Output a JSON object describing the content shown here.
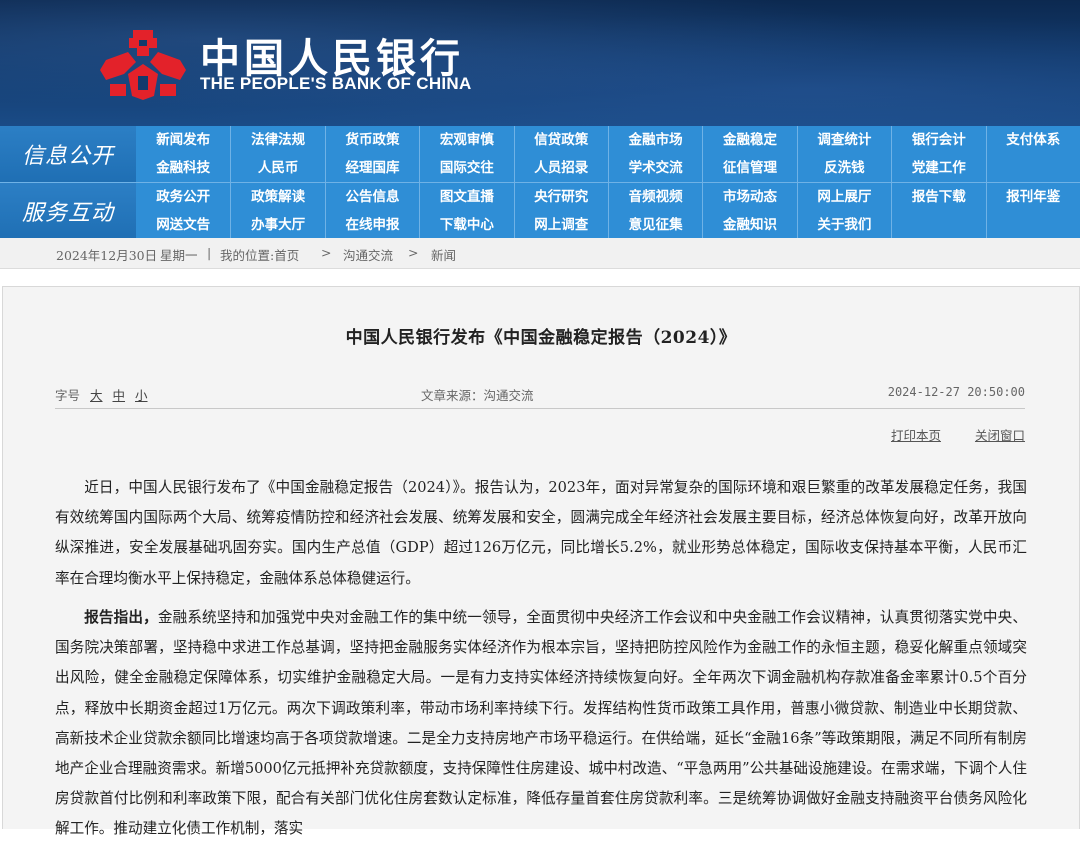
{
  "header": {
    "brand_cn": "中国人民银行",
    "brand_en": "THE PEOPLE'S BANK OF CHINA",
    "emblem_icon": "pboc-emblem-icon",
    "emblem_color": "#e3222a"
  },
  "nav": {
    "section1_label": "信息公开",
    "section2_label": "服务互动",
    "row1": [
      "新闻发布",
      "法律法规",
      "货币政策",
      "宏观审慎",
      "信贷政策",
      "金融市场",
      "金融稳定",
      "调查统计",
      "银行会计",
      "支付体系"
    ],
    "row2": [
      "金融科技",
      "人民币",
      "经理国库",
      "国际交往",
      "人员招录",
      "学术交流",
      "征信管理",
      "反洗钱",
      "党建工作",
      ""
    ],
    "row3": [
      "政务公开",
      "政策解读",
      "公告信息",
      "图文直播",
      "央行研究",
      "音频视频",
      "市场动态",
      "网上展厅",
      "报告下载",
      "报刊年鉴"
    ],
    "row4": [
      "网送文告",
      "办事大厅",
      "在线申报",
      "下载中心",
      "网上调查",
      "意见征集",
      "金融知识",
      "关于我们",
      "",
      ""
    ]
  },
  "breadcrumb": {
    "date": "2024年12月30日",
    "weekday": "星期一",
    "sep": "|",
    "location_label": "我的位置:首页",
    "arrow1": ">",
    "crumb1": "沟通交流",
    "arrow2": ">",
    "crumb2": "新闻"
  },
  "article": {
    "title": "中国人民银行发布《中国金融稳定报告（2024）》",
    "fontsize_label": "字号",
    "fontsize_large": "大",
    "fontsize_medium": "中",
    "fontsize_small": "小",
    "source": "文章来源：沟通交流",
    "datetime": "2024-12-27 20:50:00",
    "print_label": "打印本页",
    "close_label": "关闭窗口",
    "para1": "近日，中国人民银行发布了《中国金融稳定报告（2024）》。报告认为，2023年，面对异常复杂的国际环境和艰巨繁重的改革发展稳定任务，我国有效统筹国内国际两个大局、统筹疫情防控和经济社会发展、统筹发展和安全，圆满完成全年经济社会发展主要目标，经济总体恢复向好，改革开放向纵深推进，安全发展基础巩固夯实。国内生产总值（GDP）超过126万亿元，同比增长5.2%，就业形势总体稳定，国际收支保持基本平衡，人民币汇率在合理均衡水平上保持稳定，金融体系总体稳健运行。",
    "para2_lead": "报告指出，",
    "para2": "金融系统坚持和加强党中央对金融工作的集中统一领导，全面贯彻中央经济工作会议和中央金融工作会议精神，认真贯彻落实党中央、国务院决策部署，坚持稳中求进工作总基调，坚持把金融服务实体经济作为根本宗旨，坚持把防控风险作为金融工作的永恒主题，稳妥化解重点领域突出风险，健全金融稳定保障体系，切实维护金融稳定大局。一是有力支持实体经济持续恢复向好。全年两次下调金融机构存款准备金率累计0.5个百分点，释放中长期资金超过1万亿元。两次下调政策利率，带动市场利率持续下行。发挥结构性货币政策工具作用，普惠小微贷款、制造业中长期贷款、高新技术企业贷款余额同比增速均高于各项贷款增速。二是全力支持房地产市场平稳运行。在供给端，延长“金融16条”等政策期限，满足不同所有制房地产企业合理融资需求。新增5000亿元抵押补充贷款额度，支持保障性住房建设、城中村改造、“平急两用”公共基础设施建设。在需求端，下调个人住房贷款首付比例和利率政策下限，配合有关部门优化住房套数认定标准，降低存量首套住房贷款利率。三是统筹协调做好金融支持融资平台债务风险化解工作。推动建立化债工作机制，落实"
  }
}
